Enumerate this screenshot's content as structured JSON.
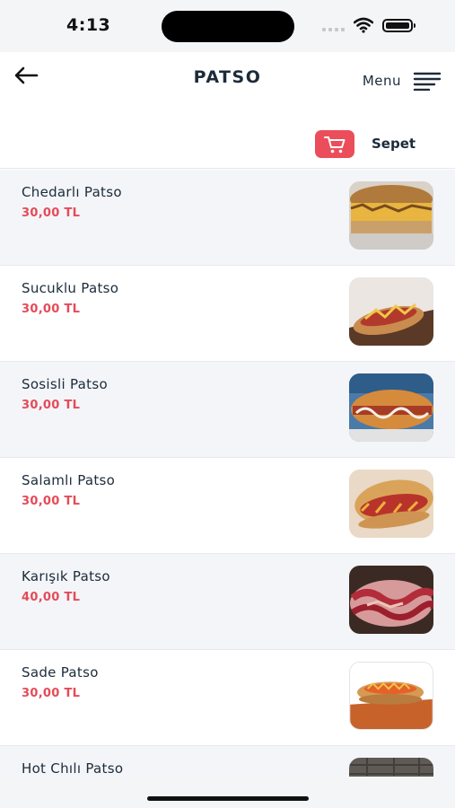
{
  "status": {
    "time": "4:13"
  },
  "header": {
    "title": "PATSO",
    "menu_label": "Menu"
  },
  "cart": {
    "label": "Sepet"
  },
  "items": [
    {
      "name": "Chedarlı Patso",
      "price": "30,00 TL"
    },
    {
      "name": "Sucuklu Patso",
      "price": "30,00 TL"
    },
    {
      "name": "Sosisli Patso",
      "price": "30,00 TL"
    },
    {
      "name": "Salamlı Patso",
      "price": "30,00 TL"
    },
    {
      "name": "Karışık Patso",
      "price": "40,00 TL"
    },
    {
      "name": "Sade Patso",
      "price": "30,00 TL"
    },
    {
      "name": "Hot Chılı Patso",
      "price": ""
    }
  ],
  "colors": {
    "accent": "#e64a57",
    "cart_button": "#ec4d5b",
    "text": "#1c2b3a",
    "row_shade": "#f3f5f9"
  }
}
